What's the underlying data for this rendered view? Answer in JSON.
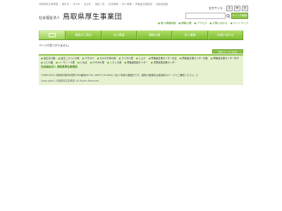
{
  "header": {
    "topline": "鳥取県厚生事業団 ｜ 東京本 ｜ 米子本 ｜ 倉吉本 ｜ 施設一覧 ｜ 採用情報 ｜ 求人情報 ｜ 障害者支援施設 ｜ 高齢者施設",
    "logo_corp": "社会福祉法人",
    "logo_name": "鳥取県厚生事業団",
    "fontsize_label": "文字サイズ",
    "fontsize_buttons": [
      "小",
      "中",
      "大"
    ],
    "search_placeholder": "",
    "search_button": "サイト内検索",
    "util_links": [
      "個人情報保護",
      "情報公開",
      "アクセス",
      "お問い合わせ",
      "サイトマップ"
    ]
  },
  "nav": {
    "items": [
      "施設のご案内",
      "法人概要",
      "情報公開",
      "求人情報",
      "お問い合わせ"
    ]
  },
  "main": {
    "notfound_text": "ページが見つかりません。",
    "prev_button": "前のページへ戻る"
  },
  "footer": {
    "links": [
      "皆生光の園",
      "皆生こひつじの家",
      "すずかけ",
      "なかの平和の家",
      "さつきの里",
      "とよだ",
      "障害者支援センター倉吉",
      "障害者支援センター鳥取",
      "障害者支援センター米子",
      "ふじの園",
      "ハーモニーの里",
      "いなば",
      "のぞみの里",
      "くらしの音",
      "障害者相談センター",
      "児童家庭支援センター"
    ],
    "org_name": "社会福祉法人 鳥取県厚生事業団",
    "address": "〒689-0201 鳥取県鳥取市伏野2259番地48 TEL (0857) 59-6020【法人本部の連絡先です。施設の連絡先は各施設のページでご確認ください。】",
    "copyright": "Copyright(c) 鳥取県厚生事業団. All Rights Reserved."
  }
}
